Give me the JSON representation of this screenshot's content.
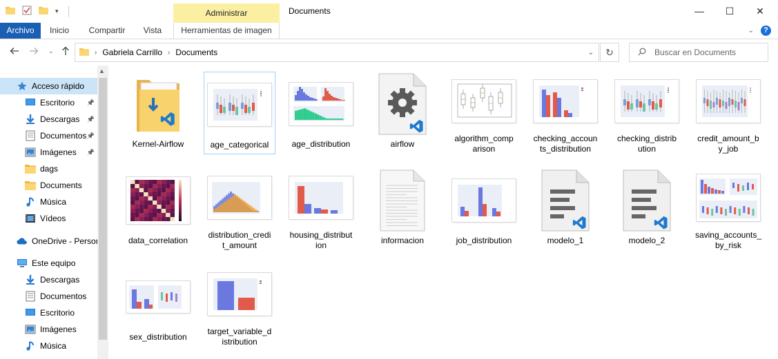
{
  "window": {
    "title": "Documents",
    "admin_tab": "Administrar",
    "min": "—",
    "max": "☐",
    "close": "✕"
  },
  "ribbon": {
    "tabs": [
      "Archivo",
      "Inicio",
      "Compartir",
      "Vista"
    ],
    "context_tab": "Herramientas de imagen",
    "help": "?"
  },
  "address": {
    "crumbs": [
      "Gabriela Carrillo",
      "Documents"
    ],
    "search_placeholder": "Buscar en Documents"
  },
  "sidebar": {
    "items": [
      {
        "label": "Acceso rápido",
        "icon": "star-icon",
        "pinned": false
      },
      {
        "label": "Escritorio",
        "icon": "desktop-icon",
        "pinned": true
      },
      {
        "label": "Descargas",
        "icon": "download-icon",
        "pinned": true
      },
      {
        "label": "Documentos",
        "icon": "document-icon",
        "pinned": true
      },
      {
        "label": "Imágenes",
        "icon": "picture-icon",
        "pinned": true
      },
      {
        "label": "dags",
        "icon": "folder-icon",
        "pinned": false
      },
      {
        "label": "Documents",
        "icon": "folder-icon",
        "pinned": false
      },
      {
        "label": "Música",
        "icon": "music-icon",
        "pinned": false
      },
      {
        "label": "Vídeos",
        "icon": "video-icon",
        "pinned": false
      },
      {
        "label": "OneDrive - Persor",
        "icon": "cloud-icon",
        "pinned": false
      },
      {
        "label": "Este equipo",
        "icon": "computer-icon",
        "pinned": false
      },
      {
        "label": "Descargas",
        "icon": "download-icon",
        "pinned": false
      },
      {
        "label": "Documentos",
        "icon": "document-icon",
        "pinned": false
      },
      {
        "label": "Escritorio",
        "icon": "desktop-icon",
        "pinned": false
      },
      {
        "label": "Imágenes",
        "icon": "picture-icon",
        "pinned": false
      },
      {
        "label": "Música",
        "icon": "music-icon",
        "pinned": false
      }
    ]
  },
  "files": [
    {
      "name": "Kernel-Airflow",
      "kind": "folder-vscode"
    },
    {
      "name": "age_categorical",
      "kind": "boxplot"
    },
    {
      "name": "age_distribution",
      "kind": "histograms"
    },
    {
      "name": "airflow",
      "kind": "settings-file"
    },
    {
      "name": "algorithm_comp arison",
      "kind": "boxplot-gray"
    },
    {
      "name": "checking_accoun ts_distribution",
      "kind": "bars-mixed"
    },
    {
      "name": "checking_distrib ution",
      "kind": "boxplot"
    },
    {
      "name": "credit_amount_b y_job",
      "kind": "boxplot-dense"
    },
    {
      "name": "data_correlation",
      "kind": "heatmap"
    },
    {
      "name": "distribution_credi t_amount",
      "kind": "histogram-overlay"
    },
    {
      "name": "housing_distribut ion",
      "kind": "bars-decreasing"
    },
    {
      "name": "informacion",
      "kind": "text-file"
    },
    {
      "name": "job_distribution",
      "kind": "bars-job"
    },
    {
      "name": "modelo_1",
      "kind": "vscode-file"
    },
    {
      "name": "modelo_2",
      "kind": "vscode-file"
    },
    {
      "name": "saving_accounts_ by_risk",
      "kind": "multi-plot"
    },
    {
      "name": "sex_distribution",
      "kind": "dual-plot"
    },
    {
      "name": "target_variable_d istribution",
      "kind": "two-bars"
    }
  ]
}
